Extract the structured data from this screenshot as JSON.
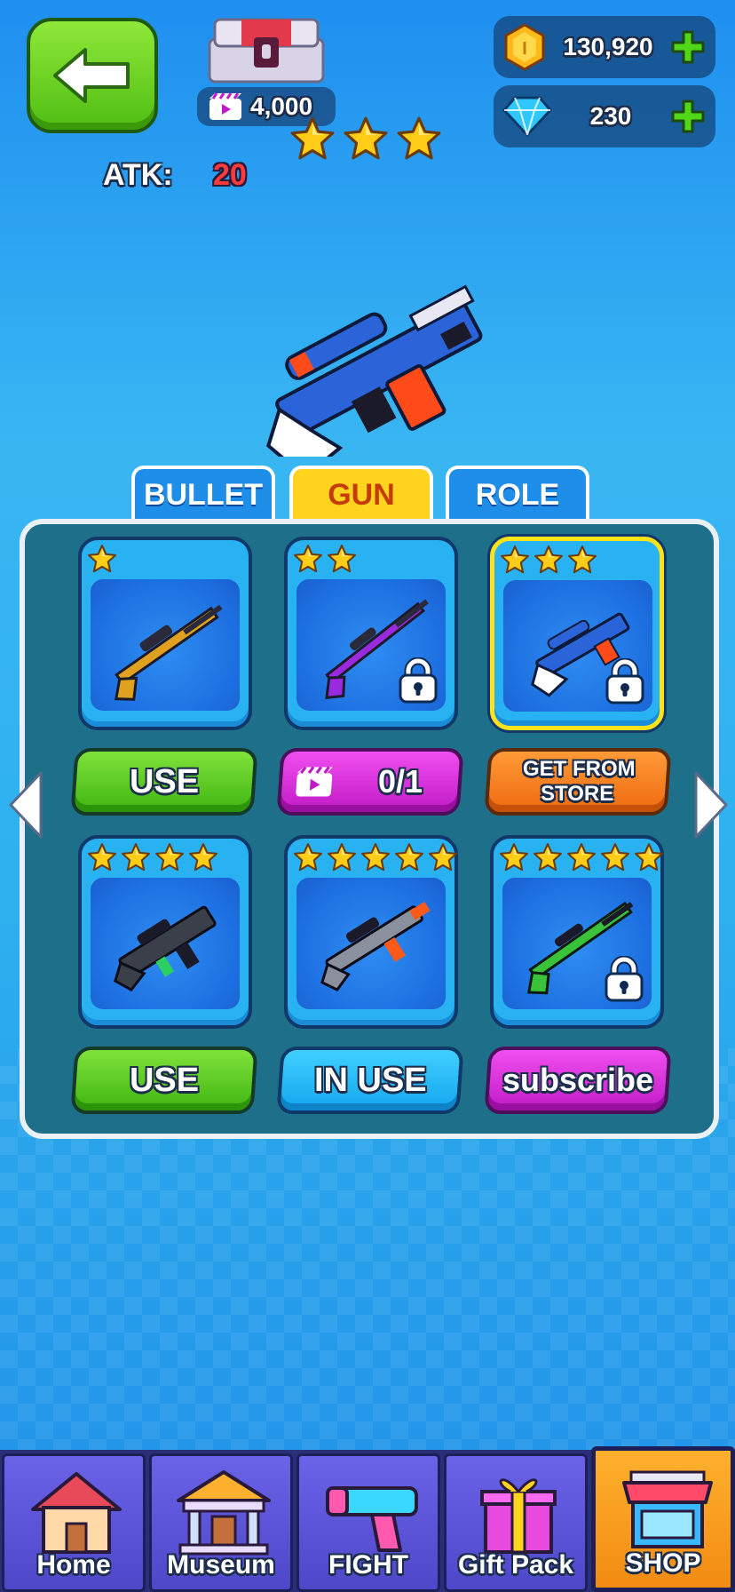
{
  "header": {
    "chest_price": "4,000",
    "stars": 3,
    "atk_label": "ATK:",
    "atk_value": "20",
    "gold_amount": "130,920",
    "gem_amount": "230"
  },
  "tabs": [
    {
      "label": "BULLET",
      "active": false
    },
    {
      "label": "GUN",
      "active": true
    },
    {
      "label": "ROLE",
      "active": false
    }
  ],
  "weapons": [
    {
      "stars": 1,
      "locked": false,
      "selected": false,
      "button": {
        "label": "USE",
        "style": "green"
      }
    },
    {
      "stars": 2,
      "locked": true,
      "selected": false,
      "button": {
        "label": "0/1",
        "style": "purple",
        "icon": "video-ad-icon"
      }
    },
    {
      "stars": 3,
      "locked": true,
      "selected": true,
      "button": {
        "label_line1": "GET FROM",
        "label_line2": "STORE",
        "style": "orange"
      }
    },
    {
      "stars": 4,
      "locked": false,
      "selected": false,
      "button": {
        "label": "USE",
        "style": "green"
      }
    },
    {
      "stars": 5,
      "locked": false,
      "selected": false,
      "button": {
        "label": "IN USE",
        "style": "blue"
      }
    },
    {
      "stars": 5,
      "locked": true,
      "selected": false,
      "button": {
        "label": "subscribe",
        "style": "purple"
      }
    }
  ],
  "nav": [
    {
      "label": "Home",
      "icon": "house-icon",
      "active": false
    },
    {
      "label": "Museum",
      "icon": "museum-icon",
      "active": false
    },
    {
      "label": "FIGHT",
      "icon": "blaster-icon",
      "active": false
    },
    {
      "label": "Gift Pack",
      "icon": "gift-icon",
      "active": false
    },
    {
      "label": "SHOP",
      "icon": "shop-icon",
      "active": true
    }
  ],
  "colors": {
    "background": "#2fb1ef",
    "panel": "#1e6f8a",
    "card": "#29b2f2",
    "selected_border": "#ffe31a",
    "atk_value": "#ff3b3b"
  }
}
